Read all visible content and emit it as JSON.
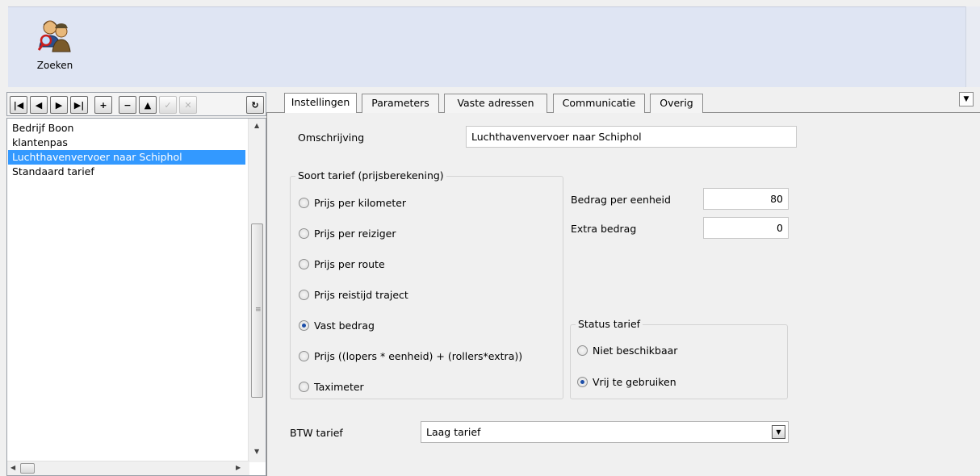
{
  "toolbar": {
    "search_label": "Zoeken"
  },
  "navigator": {
    "buttons": [
      {
        "name": "first-record-button",
        "glyph": "|◀",
        "enabled": true
      },
      {
        "name": "prior-record-button",
        "glyph": "◀",
        "enabled": true
      },
      {
        "name": "next-record-button",
        "glyph": "▶",
        "enabled": true
      },
      {
        "name": "last-record-button",
        "glyph": "▶|",
        "enabled": true
      },
      {
        "name": "insert-record-button",
        "glyph": "+",
        "enabled": true
      },
      {
        "name": "delete-record-button",
        "glyph": "−",
        "enabled": true
      },
      {
        "name": "edit-record-button",
        "glyph": "▲",
        "enabled": true
      },
      {
        "name": "post-record-button",
        "glyph": "✓",
        "enabled": false
      },
      {
        "name": "cancel-record-button",
        "glyph": "✕",
        "enabled": false
      },
      {
        "name": "refresh-button",
        "glyph": "↻",
        "enabled": true
      }
    ]
  },
  "list": {
    "items": [
      "Bedrijf Boon",
      "klantenpas",
      "Luchthavenvervoer naar Schiphol",
      "Standaard tarief"
    ],
    "selected_index": 2
  },
  "tabs": [
    "Instellingen",
    "Parameters",
    "Vaste adressen",
    "Communicatie",
    "Overig"
  ],
  "form": {
    "description_label": "Omschrijving",
    "description_value": "Luchthavenvervoer naar Schiphol",
    "tariff_type": {
      "title": "Soort tarief (prijsberekening)",
      "options": [
        "Prijs per kilometer",
        "Prijs per reiziger",
        "Prijs per route",
        "Prijs reistijd traject",
        "Vast bedrag",
        "Prijs ((lopers * eenheid) + (rollers*extra))",
        "Taximeter"
      ],
      "selected_index": 4
    },
    "amount_per_unit_label": "Bedrag per eenheid",
    "amount_per_unit_value": "80",
    "extra_amount_label": "Extra bedrag",
    "extra_amount_value": "0",
    "status": {
      "title": "Status tarief",
      "options": [
        "Niet beschikbaar",
        "Vrij te gebruiken"
      ],
      "selected_index": 1
    },
    "vat_label": "BTW tarief",
    "vat_value": "Laag tarief"
  },
  "colors": {
    "selection": "#3399ff",
    "ribbon": "#dfe5f3",
    "radio_dot": "#1c4ea8"
  }
}
